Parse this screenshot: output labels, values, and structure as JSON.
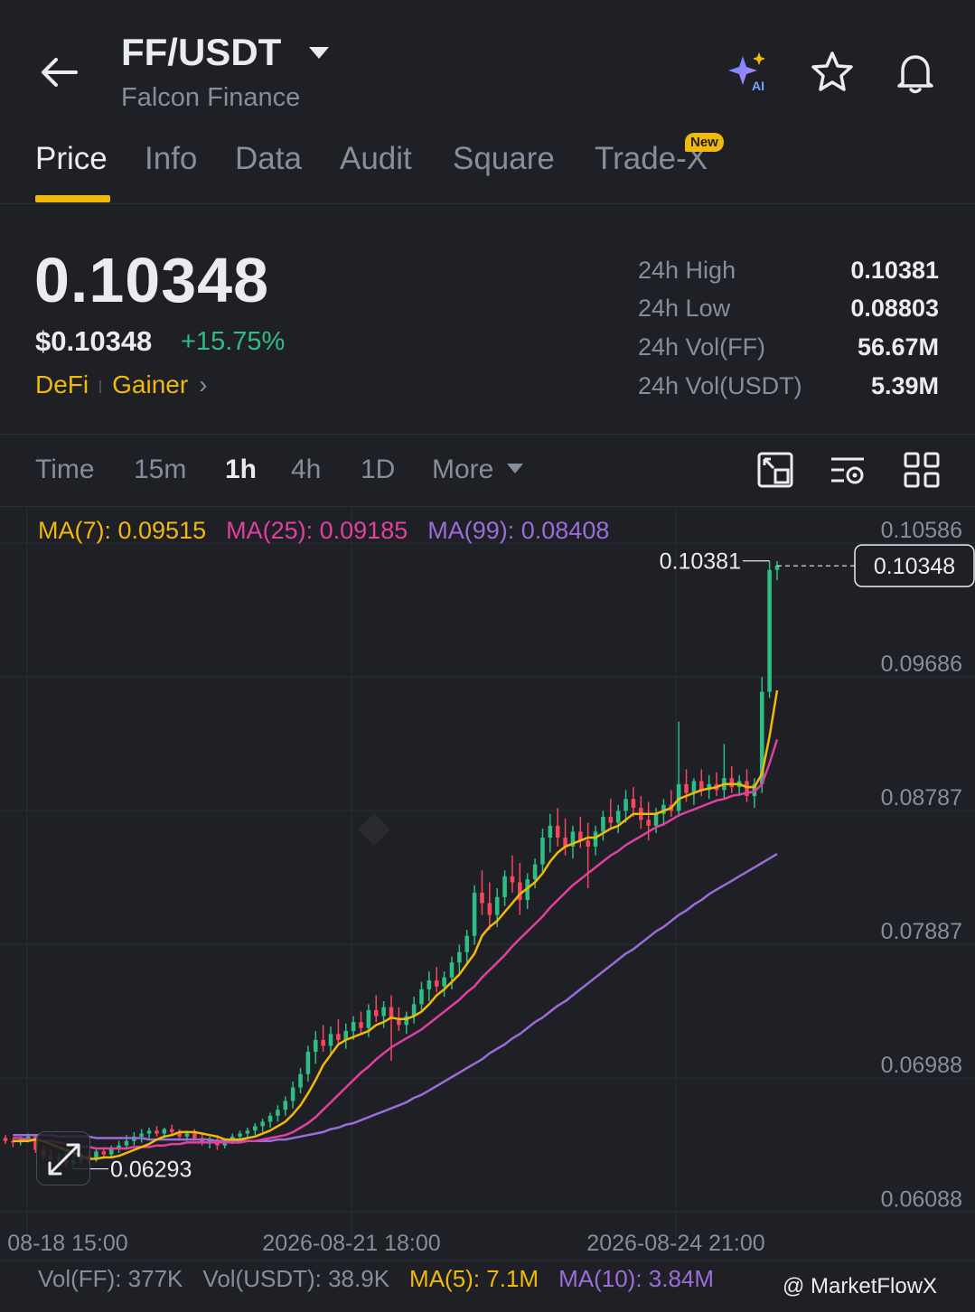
{
  "header": {
    "pair": "FF/USDT",
    "name": "Falcon Finance"
  },
  "tabs": [
    {
      "label": "Price",
      "active": true
    },
    {
      "label": "Info"
    },
    {
      "label": "Data"
    },
    {
      "label": "Audit"
    },
    {
      "label": "Square"
    },
    {
      "label": "Trade-X",
      "badge": "New"
    }
  ],
  "price": {
    "last": "0.10348",
    "usd": "$0.10348",
    "change": "+15.75%",
    "tags": [
      "DeFi",
      "Gainer"
    ]
  },
  "stats": [
    {
      "label": "24h High",
      "value": "0.10381"
    },
    {
      "label": "24h Low",
      "value": "0.08803"
    },
    {
      "label": "24h Vol(FF)",
      "value": "56.67M"
    },
    {
      "label": "24h Vol(USDT)",
      "value": "5.39M"
    }
  ],
  "timeframes": [
    {
      "label": "Time"
    },
    {
      "label": "15m"
    },
    {
      "label": "1h",
      "active": true
    },
    {
      "label": "4h"
    },
    {
      "label": "1D"
    },
    {
      "label": "More"
    }
  ],
  "indicators": {
    "ma7": "MA(7): 0.09515",
    "ma25": "MA(25): 0.09185",
    "ma99": "MA(99): 0.08408"
  },
  "volume": {
    "vol_ff": "Vol(FF): 377K",
    "vol_usdt": "Vol(USDT): 38.9K",
    "ma5": "MA(5): 7.1M",
    "ma10": "MA(10): 3.84M"
  },
  "watermark": "@ MarketFlowX",
  "colors": {
    "accent": "#f0b90b",
    "up": "#2ebd85",
    "down": "#f6465d",
    "ma7": "#f0b90b",
    "ma25": "#e040a0",
    "ma99": "#9b6dd9"
  },
  "chart_data": {
    "type": "candlestick",
    "y_ticks": [
      "0.10586",
      "0.09686",
      "0.08787",
      "0.07887",
      "0.06988",
      "0.06088"
    ],
    "ylim": [
      0.0595,
      0.1075
    ],
    "x_ticks": [
      "08-18 15:00",
      "2026-08-21 18:00",
      "2026-08-24 21:00"
    ],
    "current_price": "0.10348",
    "high_marker": "0.10381",
    "low_marker": "0.06293",
    "candles": [
      [
        0.065,
        0.0652,
        0.0646,
        0.0648
      ],
      [
        0.0648,
        0.065,
        0.0644,
        0.0647
      ],
      [
        0.0647,
        0.0651,
        0.0645,
        0.0649
      ],
      [
        0.0649,
        0.0653,
        0.0647,
        0.0651
      ],
      [
        0.0651,
        0.0652,
        0.064,
        0.0642
      ],
      [
        0.0642,
        0.0645,
        0.0636,
        0.0638
      ],
      [
        0.0638,
        0.0642,
        0.0634,
        0.0636
      ],
      [
        0.0636,
        0.064,
        0.0632,
        0.0637
      ],
      [
        0.0637,
        0.0641,
        0.0631,
        0.0633
      ],
      [
        0.0633,
        0.0638,
        0.0629,
        0.0635
      ],
      [
        0.0635,
        0.064,
        0.0632,
        0.0638
      ],
      [
        0.0638,
        0.0641,
        0.0633,
        0.0636
      ],
      [
        0.0636,
        0.0643,
        0.0634,
        0.0641
      ],
      [
        0.0641,
        0.0644,
        0.0636,
        0.0639
      ],
      [
        0.0639,
        0.0645,
        0.0637,
        0.0643
      ],
      [
        0.0643,
        0.0648,
        0.064,
        0.0645
      ],
      [
        0.0645,
        0.0652,
        0.0642,
        0.0648
      ],
      [
        0.0648,
        0.0654,
        0.0645,
        0.0651
      ],
      [
        0.0651,
        0.0656,
        0.0647,
        0.0653
      ],
      [
        0.0653,
        0.0657,
        0.065,
        0.0655
      ],
      [
        0.0655,
        0.0658,
        0.0651,
        0.0653
      ],
      [
        0.0653,
        0.0657,
        0.065,
        0.0656
      ],
      [
        0.0656,
        0.0659,
        0.0652,
        0.0654
      ],
      [
        0.0654,
        0.0656,
        0.0649,
        0.0651
      ],
      [
        0.0651,
        0.0655,
        0.0648,
        0.0653
      ],
      [
        0.0653,
        0.0656,
        0.0649,
        0.065
      ],
      [
        0.065,
        0.0653,
        0.0645,
        0.0647
      ],
      [
        0.0647,
        0.0651,
        0.0643,
        0.0649
      ],
      [
        0.0649,
        0.0652,
        0.0642,
        0.0645
      ],
      [
        0.0645,
        0.065,
        0.0643,
        0.0648
      ],
      [
        0.0648,
        0.0653,
        0.0646,
        0.0651
      ],
      [
        0.0651,
        0.0655,
        0.0648,
        0.0653
      ],
      [
        0.0653,
        0.0657,
        0.065,
        0.0655
      ],
      [
        0.0655,
        0.066,
        0.0652,
        0.0658
      ],
      [
        0.0658,
        0.0663,
        0.0654,
        0.0661
      ],
      [
        0.0661,
        0.0667,
        0.0657,
        0.0665
      ],
      [
        0.0665,
        0.0672,
        0.0661,
        0.0669
      ],
      [
        0.0669,
        0.0678,
        0.0665,
        0.0675
      ],
      [
        0.0675,
        0.0688,
        0.067,
        0.0684
      ],
      [
        0.0684,
        0.0697,
        0.068,
        0.0693
      ],
      [
        0.0693,
        0.0712,
        0.0688,
        0.0708
      ],
      [
        0.0708,
        0.0722,
        0.07,
        0.0716
      ],
      [
        0.0716,
        0.0726,
        0.0708,
        0.0712
      ],
      [
        0.0712,
        0.0725,
        0.0706,
        0.072
      ],
      [
        0.072,
        0.073,
        0.0712,
        0.0716
      ],
      [
        0.0716,
        0.0727,
        0.071,
        0.0722
      ],
      [
        0.0722,
        0.0732,
        0.0716,
        0.0728
      ],
      [
        0.0728,
        0.0735,
        0.072,
        0.0724
      ],
      [
        0.0724,
        0.074,
        0.0718,
        0.0736
      ],
      [
        0.0736,
        0.0746,
        0.0728,
        0.0732
      ],
      [
        0.0732,
        0.0742,
        0.0724,
        0.0738
      ],
      [
        0.0738,
        0.0746,
        0.0702,
        0.073
      ],
      [
        0.073,
        0.0738,
        0.0722,
        0.0726
      ],
      [
        0.0726,
        0.0735,
        0.072,
        0.0732
      ],
      [
        0.0732,
        0.0745,
        0.0727,
        0.074
      ],
      [
        0.074,
        0.0755,
        0.0735,
        0.075
      ],
      [
        0.075,
        0.0762,
        0.0742,
        0.0756
      ],
      [
        0.0756,
        0.0765,
        0.0748,
        0.0752
      ],
      [
        0.0752,
        0.0762,
        0.0745,
        0.0758
      ],
      [
        0.0758,
        0.0772,
        0.075,
        0.0768
      ],
      [
        0.0768,
        0.078,
        0.076,
        0.0775
      ],
      [
        0.0775,
        0.079,
        0.0768,
        0.0786
      ],
      [
        0.0786,
        0.082,
        0.078,
        0.0815
      ],
      [
        0.0815,
        0.083,
        0.08,
        0.0808
      ],
      [
        0.0808,
        0.0822,
        0.079,
        0.08
      ],
      [
        0.08,
        0.0818,
        0.0792,
        0.0812
      ],
      [
        0.0812,
        0.083,
        0.0806,
        0.0826
      ],
      [
        0.0826,
        0.084,
        0.0815,
        0.0822
      ],
      [
        0.0822,
        0.0835,
        0.08,
        0.081
      ],
      [
        0.081,
        0.0828,
        0.0804,
        0.0824
      ],
      [
        0.0824,
        0.0838,
        0.0818,
        0.0834
      ],
      [
        0.0834,
        0.0858,
        0.0828,
        0.0852
      ],
      [
        0.0852,
        0.0868,
        0.0842,
        0.086
      ],
      [
        0.086,
        0.0872,
        0.0846,
        0.0852
      ],
      [
        0.0852,
        0.0865,
        0.084,
        0.0846
      ],
      [
        0.0846,
        0.086,
        0.0838,
        0.0856
      ],
      [
        0.0856,
        0.0866,
        0.0845,
        0.085
      ],
      [
        0.085,
        0.0862,
        0.0818,
        0.0846
      ],
      [
        0.0846,
        0.086,
        0.084,
        0.0856
      ],
      [
        0.0856,
        0.087,
        0.085,
        0.0866
      ],
      [
        0.0866,
        0.0878,
        0.0858,
        0.0862
      ],
      [
        0.0862,
        0.0874,
        0.0855,
        0.087
      ],
      [
        0.087,
        0.0884,
        0.0862,
        0.0878
      ],
      [
        0.0878,
        0.0886,
        0.0866,
        0.0872
      ],
      [
        0.0872,
        0.088,
        0.0858,
        0.0864
      ],
      [
        0.0864,
        0.0876,
        0.085,
        0.086
      ],
      [
        0.086,
        0.0872,
        0.0855,
        0.0868
      ],
      [
        0.0868,
        0.0878,
        0.086,
        0.0874
      ],
      [
        0.0874,
        0.0884,
        0.0866,
        0.087
      ],
      [
        0.087,
        0.093,
        0.0866,
        0.0888
      ],
      [
        0.0888,
        0.0898,
        0.0876,
        0.0882
      ],
      [
        0.0882,
        0.0892,
        0.0874,
        0.089
      ],
      [
        0.089,
        0.0898,
        0.088,
        0.0884
      ],
      [
        0.0884,
        0.0894,
        0.0878,
        0.0888
      ],
      [
        0.0888,
        0.0896,
        0.088,
        0.0884
      ],
      [
        0.0884,
        0.0915,
        0.0878,
        0.0892
      ],
      [
        0.0892,
        0.09,
        0.0882,
        0.0886
      ],
      [
        0.0886,
        0.0894,
        0.088,
        0.089
      ],
      [
        0.089,
        0.0898,
        0.0876,
        0.088
      ],
      [
        0.088,
        0.0892,
        0.0872,
        0.0888
      ],
      [
        0.0888,
        0.096,
        0.0882,
        0.095
      ],
      [
        0.095,
        0.1038,
        0.0946,
        0.1032
      ],
      [
        0.1032,
        0.1038,
        0.1025,
        0.1035
      ]
    ],
    "ma7": [
      0.0648,
      0.0648,
      0.0648,
      0.0649,
      0.0648,
      0.0646,
      0.0644,
      0.0642,
      0.064,
      0.0638,
      0.0636,
      0.0636,
      0.0637,
      0.0637,
      0.0638,
      0.064,
      0.0642,
      0.0644,
      0.0646,
      0.0649,
      0.0651,
      0.0652,
      0.0654,
      0.0654,
      0.0654,
      0.0653,
      0.0652,
      0.0651,
      0.0649,
      0.0649,
      0.0649,
      0.065,
      0.0651,
      0.0653,
      0.0655,
      0.0658,
      0.0661,
      0.0666,
      0.0672,
      0.068,
      0.0689,
      0.0699,
      0.0706,
      0.0713,
      0.0716,
      0.0718,
      0.072,
      0.0722,
      0.0726,
      0.0728,
      0.0731,
      0.073,
      0.073,
      0.0732,
      0.0735,
      0.074,
      0.0746,
      0.075,
      0.0755,
      0.076,
      0.0767,
      0.0774,
      0.0786,
      0.0792,
      0.0796,
      0.0802,
      0.0808,
      0.0814,
      0.0818,
      0.0822,
      0.0828,
      0.0836,
      0.0842,
      0.0846,
      0.0848,
      0.085,
      0.0852,
      0.0852,
      0.0855,
      0.0858,
      0.086,
      0.0864,
      0.0868,
      0.0868,
      0.0868,
      0.0868,
      0.087,
      0.0872,
      0.0878,
      0.088,
      0.0882,
      0.0884,
      0.0885,
      0.0886,
      0.0888,
      0.0888,
      0.0888,
      0.0886,
      0.0886,
      0.0895,
      0.092,
      0.0951
    ],
    "ma25": [
      0.065,
      0.065,
      0.0649,
      0.0649,
      0.0648,
      0.0648,
      0.0647,
      0.0646,
      0.0645,
      0.0644,
      0.0644,
      0.0643,
      0.0643,
      0.0643,
      0.0643,
      0.0643,
      0.0644,
      0.0644,
      0.0644,
      0.0645,
      0.0645,
      0.0646,
      0.0646,
      0.0647,
      0.0647,
      0.0647,
      0.0647,
      0.0647,
      0.0647,
      0.0647,
      0.0647,
      0.0648,
      0.0648,
      0.0649,
      0.065,
      0.0651,
      0.0652,
      0.0654,
      0.0657,
      0.066,
      0.0664,
      0.0669,
      0.0674,
      0.0679,
      0.0684,
      0.0689,
      0.0694,
      0.0698,
      0.0703,
      0.0707,
      0.0711,
      0.0714,
      0.0717,
      0.072,
      0.0723,
      0.0727,
      0.0731,
      0.0735,
      0.0739,
      0.0743,
      0.0748,
      0.0752,
      0.0758,
      0.0763,
      0.0768,
      0.0773,
      0.0779,
      0.0784,
      0.0789,
      0.0794,
      0.0799,
      0.0805,
      0.081,
      0.0815,
      0.082,
      0.0824,
      0.0828,
      0.0832,
      0.0836,
      0.084,
      0.0843,
      0.0847,
      0.085,
      0.0853,
      0.0856,
      0.0859,
      0.0861,
      0.0864,
      0.0867,
      0.0869,
      0.0871,
      0.0873,
      0.0875,
      0.0877,
      0.0878,
      0.088,
      0.0881,
      0.0882,
      0.0883,
      0.0888,
      0.0902,
      0.0918
    ],
    "ma99": [
      0.0652,
      0.0652,
      0.0652,
      0.0652,
      0.0652,
      0.0652,
      0.0651,
      0.0651,
      0.0651,
      0.0651,
      0.0651,
      0.065,
      0.065,
      0.065,
      0.065,
      0.065,
      0.065,
      0.065,
      0.0649,
      0.0649,
      0.0649,
      0.0649,
      0.0649,
      0.0649,
      0.0649,
      0.0649,
      0.0649,
      0.0648,
      0.0648,
      0.0648,
      0.0648,
      0.0648,
      0.0648,
      0.0648,
      0.0648,
      0.0649,
      0.0649,
      0.065,
      0.0651,
      0.0652,
      0.0653,
      0.0654,
      0.0656,
      0.0657,
      0.0659,
      0.066,
      0.0662,
      0.0664,
      0.0666,
      0.0668,
      0.067,
      0.0672,
      0.0674,
      0.0677,
      0.0679,
      0.0682,
      0.0685,
      0.0688,
      0.0691,
      0.0694,
      0.0697,
      0.07,
      0.0703,
      0.0707,
      0.071,
      0.0713,
      0.0717,
      0.072,
      0.0724,
      0.0728,
      0.0731,
      0.0735,
      0.0739,
      0.0742,
      0.0746,
      0.075,
      0.0754,
      0.0758,
      0.0762,
      0.0766,
      0.077,
      0.0774,
      0.0777,
      0.0781,
      0.0785,
      0.0789,
      0.0792,
      0.0796,
      0.08,
      0.0803,
      0.0807,
      0.081,
      0.0814,
      0.0817,
      0.082,
      0.0823,
      0.0826,
      0.0829,
      0.0832,
      0.0835,
      0.0838,
      0.0841
    ]
  }
}
